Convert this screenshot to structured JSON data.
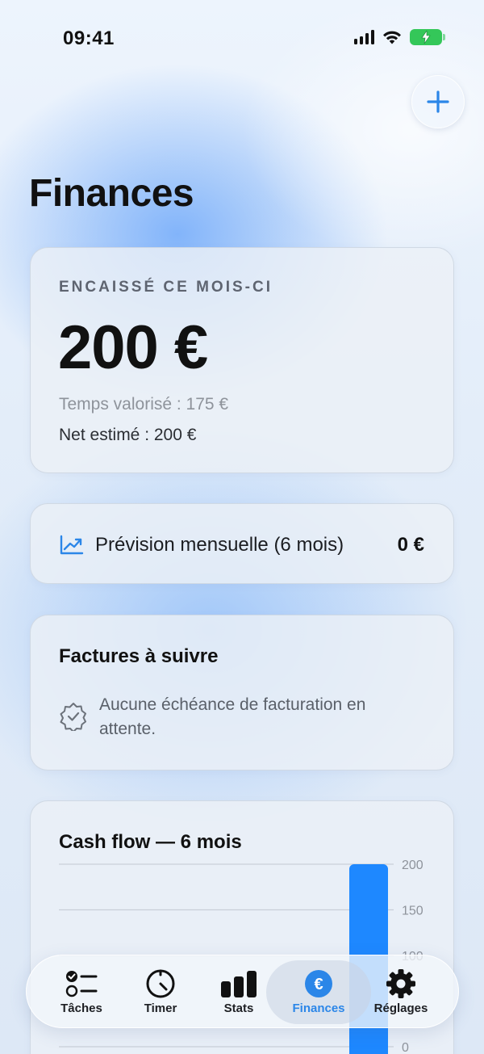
{
  "status_bar": {
    "time": "09:41"
  },
  "page": {
    "title": "Finances"
  },
  "summary_card": {
    "kicker": "ENCAISSÉ CE MOIS-CI",
    "amount": "200 €",
    "time_value": "Temps valorisé : 175 €",
    "net_estimate": "Net estimé : 200 €"
  },
  "forecast_card": {
    "label": "Prévision mensuelle (6 mois)",
    "value": "0 €"
  },
  "invoices_card": {
    "title": "Factures à suivre",
    "message": "Aucune échéance de facturation en attente."
  },
  "cashflow_card": {
    "title": "Cash flow — 6 mois"
  },
  "chart_data": {
    "type": "bar",
    "y_ticks": [
      "200",
      "150",
      "100",
      "0"
    ],
    "ylim": [
      0,
      200
    ],
    "values": [
      200
    ],
    "bar_color": "#1e88ff"
  },
  "tabs": [
    {
      "label": "Tâches",
      "icon": "checklist-icon"
    },
    {
      "label": "Timer",
      "icon": "timer-icon"
    },
    {
      "label": "Stats",
      "icon": "bar-chart-icon"
    },
    {
      "label": "Finances",
      "icon": "euro-icon",
      "active": true
    },
    {
      "label": "Réglages",
      "icon": "gear-icon"
    }
  ],
  "colors": {
    "accent": "#2b86e8",
    "battery": "#34c759"
  }
}
